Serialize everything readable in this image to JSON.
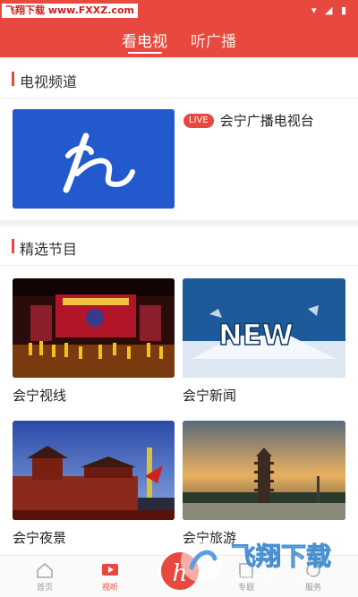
{
  "watermark_top": "飞翔下载 www.FXXZ.com",
  "status_icons": "▾ ◢ ▮",
  "top_tabs": [
    {
      "label": "看电视",
      "active": true
    },
    {
      "label": "听广播",
      "active": false
    }
  ],
  "tv_section": {
    "title": "电视频道",
    "channel": {
      "badge": "LIVE",
      "name": "会宁广播电视台",
      "logo_letter": "h"
    }
  },
  "programs_section": {
    "title": "精选节目",
    "items": [
      {
        "label": "会宁视线"
      },
      {
        "label": "会宁新闻",
        "thumb_text": "NEW"
      },
      {
        "label": "会宁夜景"
      },
      {
        "label": "会宁旅游"
      }
    ]
  },
  "bottom_nav": [
    {
      "label": "首页",
      "icon": "home-icon",
      "active": false
    },
    {
      "label": "视听",
      "icon": "tv-icon",
      "active": true
    },
    {
      "label": "专题",
      "icon": "topic-icon",
      "active": false
    },
    {
      "label": "服务",
      "icon": "service-icon",
      "active": false
    }
  ],
  "center_button_glyph": "h",
  "watermark_bottom": {
    "title": "飞翔下载",
    "url": "www.fxxz.com"
  },
  "colors": {
    "brand": "#e8493e",
    "live": "#e8493e",
    "channel_bg": "#1f55c8"
  }
}
